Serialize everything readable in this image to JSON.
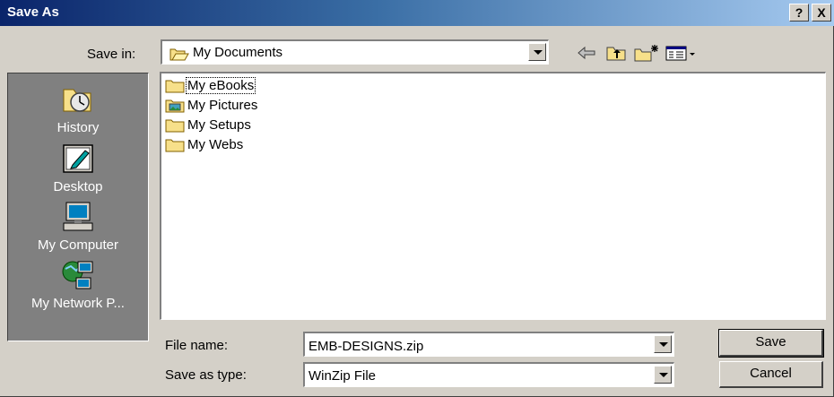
{
  "window": {
    "title": "Save As",
    "help_glyph": "?",
    "close_glyph": "X"
  },
  "save_in": {
    "label": "Save in:",
    "value": "My Documents",
    "icon": "open-folder-icon"
  },
  "toolbar": {
    "icons": [
      "back-arrow-icon",
      "up-one-level-icon",
      "create-new-folder-icon",
      "view-menu-icon"
    ]
  },
  "places": [
    {
      "label": "History",
      "icon": "history-clock-icon"
    },
    {
      "label": "Desktop",
      "icon": "desktop-icon"
    },
    {
      "label": "My Computer",
      "icon": "computer-icon"
    },
    {
      "label": "My Network P...",
      "icon": "network-places-icon"
    }
  ],
  "files": [
    {
      "name": "My eBooks",
      "icon": "folder-icon",
      "focused": true
    },
    {
      "name": "My Pictures",
      "icon": "pictures-folder-icon",
      "focused": false
    },
    {
      "name": "My Setups",
      "icon": "folder-icon",
      "focused": false
    },
    {
      "name": "My Webs",
      "icon": "folder-icon",
      "focused": false
    }
  ],
  "file_name": {
    "label": "File name:",
    "value": "EMB-DESIGNS.zip"
  },
  "save_as_type": {
    "label": "Save as type:",
    "value": "WinZip File"
  },
  "buttons": {
    "save": "Save",
    "cancel": "Cancel"
  },
  "colors": {
    "title_gradient_start": "#0a246a",
    "title_gradient_end": "#a6caf0",
    "dialog_face": "#d4d0c8",
    "places_bar": "#808080",
    "folder_yellow": "#f7e08a"
  }
}
